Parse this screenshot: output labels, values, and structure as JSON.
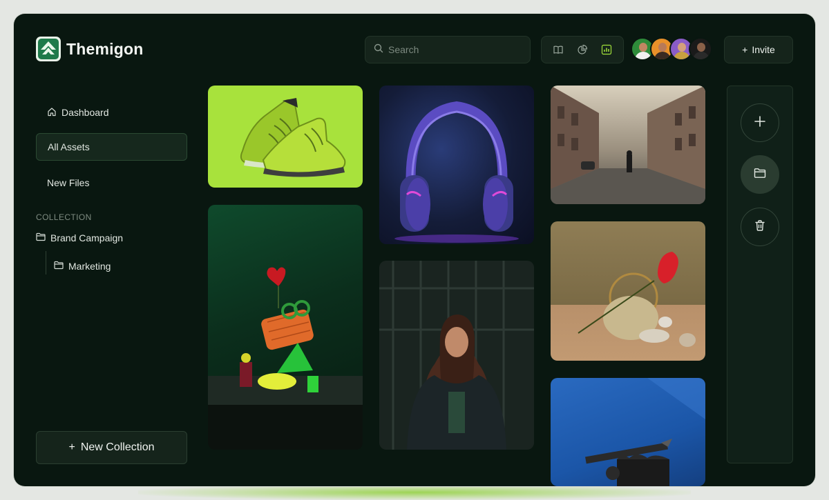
{
  "app": {
    "name": "Themigon",
    "logo_icon": "mountain-logo-icon"
  },
  "search": {
    "placeholder": "Search",
    "value": ""
  },
  "view_switcher": {
    "options": [
      "book-icon",
      "pie-chart-icon",
      "bar-chart-icon"
    ],
    "active": "bar-chart-icon"
  },
  "collaborators": [
    {
      "name": "avatar-1",
      "color": "#2e8b3a"
    },
    {
      "name": "avatar-2",
      "color": "#e8902a"
    },
    {
      "name": "avatar-3",
      "color": "#8a5cc8"
    },
    {
      "name": "avatar-4",
      "color": "#1a1a1a"
    }
  ],
  "invite": {
    "label": "Invite",
    "icon": "+"
  },
  "sidebar": {
    "items": [
      {
        "label": "Dashboard",
        "icon": "home-icon"
      },
      {
        "label": "All Assets",
        "active": true
      },
      {
        "label": "New Files"
      }
    ],
    "collection_label": "COLLECTION",
    "collections": [
      {
        "label": "Brand Campaign",
        "icon": "folder-icon"
      },
      {
        "label": "Marketing",
        "icon": "folder-icon"
      }
    ],
    "new_collection": {
      "label": "New Collection",
      "icon": "+"
    }
  },
  "gallery": [
    {
      "name": "sneakers-image",
      "bg": "#a8e23c"
    },
    {
      "name": "headphones-image",
      "bg": "#141c38"
    },
    {
      "name": "street-image",
      "bg": "#8b8474"
    },
    {
      "name": "still-life-green-image",
      "bg": "#0f3a26"
    },
    {
      "name": "portrait-image",
      "bg": "#1a2420"
    },
    {
      "name": "stone-flower-image",
      "bg": "#8f7d55"
    },
    {
      "name": "blue-pedestal-image",
      "bg": "#1b56a8"
    }
  ],
  "actions": [
    "add-icon",
    "folder-icon",
    "trash-icon"
  ],
  "theme": {
    "accent": "#a3e23b",
    "window_bg": "#091710",
    "panel_bg": "#15241b"
  }
}
